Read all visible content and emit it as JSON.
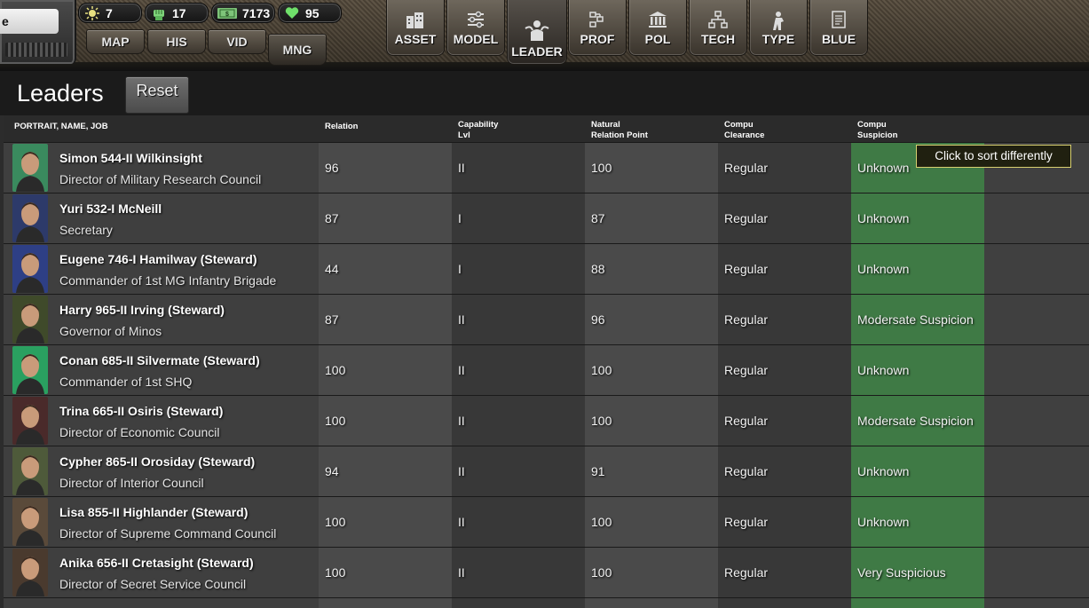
{
  "app": {
    "search_value": "e"
  },
  "resources": [
    {
      "icon": "sun-icon",
      "value": "7"
    },
    {
      "icon": "fist-icon",
      "value": "17"
    },
    {
      "icon": "money-icon",
      "value": "7173"
    },
    {
      "icon": "heart-icon",
      "value": "95"
    }
  ],
  "nav_small": [
    "MAP",
    "HIS",
    "VID",
    "MNG"
  ],
  "nav_big": [
    {
      "label": "ASSET",
      "icon": "buildings-icon"
    },
    {
      "label": "MODEL",
      "icon": "sliders-icon"
    },
    {
      "label": "LEADER",
      "icon": "leader-icon"
    },
    {
      "label": "PROF",
      "icon": "chart-icon"
    },
    {
      "label": "POL",
      "icon": "government-icon"
    },
    {
      "label": "TECH",
      "icon": "hierarchy-icon"
    },
    {
      "label": "TYPE",
      "icon": "soldier-icon"
    },
    {
      "label": "BLUE",
      "icon": "document-icon"
    }
  ],
  "page": {
    "title": "Leaders",
    "reset_label": "Reset"
  },
  "table": {
    "headers": {
      "name": "PORTRAIT, NAME, JOB",
      "relation": "Relation",
      "capability_1": "Capability",
      "capability_2": "Lvl",
      "natural_1": "Natural",
      "natural_2": "Relation Point",
      "clearance_1": "Compu",
      "clearance_2": "Clearance",
      "suspicion_1": "Compu",
      "suspicion_2": "Suspicion"
    },
    "tooltip": "Click to sort differently",
    "rows": [
      {
        "name": "Simon 544-II Wilkinsight",
        "job": "Director of Military Research Council",
        "relation": "96",
        "capability": "II",
        "natural": "100",
        "clearance": "Regular",
        "suspicion": "Unknown",
        "portrait": "#3a8a5e"
      },
      {
        "name": "Yuri 532-I McNeill",
        "job": "Secretary",
        "relation": "87",
        "capability": "I",
        "natural": "87",
        "clearance": "Regular",
        "suspicion": "Unknown",
        "portrait": "#2d3a6a"
      },
      {
        "name": "Eugene 746-I Hamilway (Steward)",
        "job": "Commander of 1st MG Infantry Brigade",
        "relation": "44",
        "capability": "I",
        "natural": "88",
        "clearance": "Regular",
        "suspicion": "Unknown",
        "portrait": "#2e3f85"
      },
      {
        "name": "Harry 965-II Irving (Steward)",
        "job": "Governor of Minos",
        "relation": "87",
        "capability": "II",
        "natural": "96",
        "clearance": "Regular",
        "suspicion": "Modersate Suspicion",
        "portrait": "#3f4a2a"
      },
      {
        "name": "Conan 685-II Silvermate (Steward)",
        "job": "Commander of 1st SHQ",
        "relation": "100",
        "capability": "II",
        "natural": "100",
        "clearance": "Regular",
        "suspicion": "Unknown",
        "portrait": "#2aa060"
      },
      {
        "name": "Trina 665-II Osiris (Steward)",
        "job": "Director of Economic Council",
        "relation": "100",
        "capability": "II",
        "natural": "100",
        "clearance": "Regular",
        "suspicion": "Modersate Suspicion",
        "portrait": "#4a2a2a"
      },
      {
        "name": "Cypher 865-II Orosiday (Steward)",
        "job": "Director of Interior Council",
        "relation": "94",
        "capability": "II",
        "natural": "91",
        "clearance": "Regular",
        "suspicion": "Unknown",
        "portrait": "#4e5a3a"
      },
      {
        "name": "Lisa 855-II Highlander (Steward)",
        "job": "Director of Supreme Command Council",
        "relation": "100",
        "capability": "II",
        "natural": "100",
        "clearance": "Regular",
        "suspicion": "Unknown",
        "portrait": "#5a4a3a"
      },
      {
        "name": "Anika 656-II Cretasight (Steward)",
        "job": "Director of Secret Service Council",
        "relation": "100",
        "capability": "II",
        "natural": "100",
        "clearance": "Regular",
        "suspicion": "Very Suspicious",
        "portrait": "#4a3a2e"
      }
    ]
  }
}
